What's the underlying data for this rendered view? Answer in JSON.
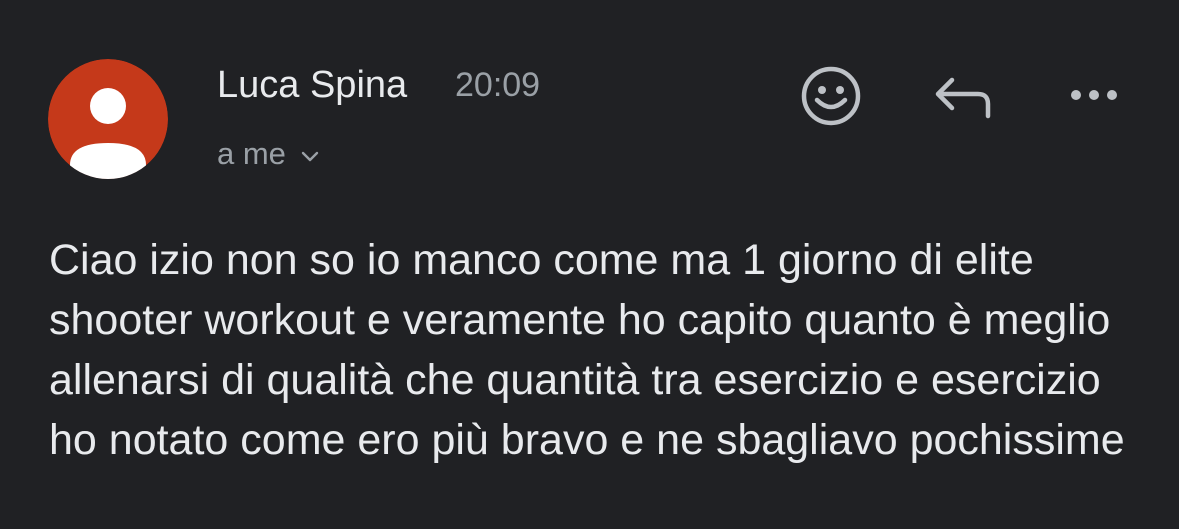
{
  "header": {
    "sender_name": "Luca Spina",
    "time": "20:09",
    "recipient": "a me",
    "avatar_color": "#c5391a"
  },
  "actions": {
    "emoji_icon": "emoji-smile-icon",
    "reply_icon": "reply-icon",
    "more_icon": "more-horizontal-icon"
  },
  "message": {
    "body": "Ciao izio non so io manco come ma 1 giorno di elite shooter workout e veramente ho capito quanto è meglio allenarsi di qualità che quantità tra esercizio e esercizio ho notato come ero più bravo e ne sbagliavo pochissime"
  }
}
